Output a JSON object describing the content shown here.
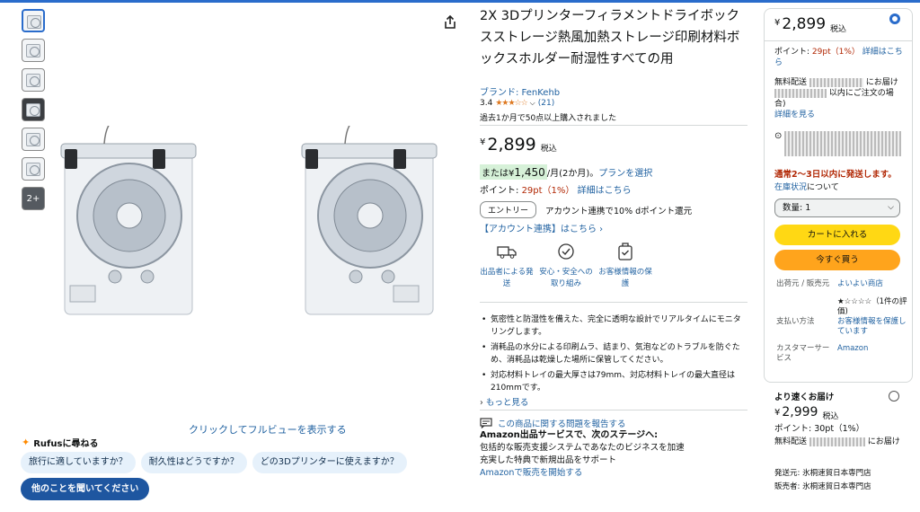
{
  "thumbnails": {
    "more_label": "2+"
  },
  "image": {
    "full_view_label": "クリックしてフルビューを表示する"
  },
  "rufus": {
    "title": "Rufusに尋ねる",
    "chips": [
      "旅行に適していますか？",
      "耐久性はどうですか？",
      "どの3Dプリンターに使えますか？"
    ],
    "ask_label": "他のことを聞いてください"
  },
  "product": {
    "title": "2X 3Dプリンターフィラメントドライボックスストレージ熱風加熱ストレージ印刷材料ボックスホルダー耐湿性すべての用",
    "brand": "ブランド: FenKehb",
    "rating": "3.4",
    "stars": "★★★☆☆",
    "rating_count": "(21)",
    "bought": "過去1か月で50点以上購入されました",
    "price_symbol": "¥",
    "price": "2,899",
    "tax_label": "税込",
    "installment_prefix": "または¥",
    "installment_amount": "1,450",
    "installment_suffix": " /月(2か月)。",
    "plan_link": "プランを選択",
    "points_label": "ポイント: ",
    "points_value": "29pt（1%）",
    "points_link": "詳細はこちら",
    "entry_label": "エントリー",
    "docomo_text": "アカウント連携で10% dポイント還元",
    "account_link": "【アカウント連携】はこちら ›",
    "features": [
      {
        "icon": "truck-icon",
        "label": "出品者による発送"
      },
      {
        "icon": "shield-icon",
        "label": "安心・安全への取り組み"
      },
      {
        "icon": "lock-icon",
        "label": "お客様情報の保護"
      }
    ],
    "bullets": [
      "気密性と防湿性を備えた、完全に透明な設計でリアルタイムにモニタリングします。",
      "消耗品の水分による印刷ムラ、詰まり、気泡などのトラブルを防ぐため、消耗品は乾燥した場所に保管してください。",
      "対応材料トレイの最大厚さは79mm、対応材料トレイの最大直径は210mmです。"
    ],
    "more_link": "もっと見る",
    "report_link": "この商品に関する問題を報告する",
    "amz_services_title": "Amazon出品サービスで、次のステージへ:",
    "amz_services_line1": "包括的な販売支援システムであなたのビジネスを加速",
    "amz_services_line2": "充実した特典で新規出品をサポート",
    "amz_services_link": "Amazonで販売を開始する"
  },
  "buybox": {
    "price_symbol": "¥",
    "price": "2,899",
    "tax_label": "税込",
    "points_label": "ポイント: ",
    "points_value": "29pt（1%）",
    "points_link": "詳細はこちら",
    "delivery_prefix": "無料配送",
    "delivery_suffix": "にお届け",
    "delivery_line2": "以内にご注文の場合)",
    "details_link": "詳細を見る",
    "ship_fast": "通常2～3日以内に発送します。",
    "stock_link": "在庫状況",
    "stock_suffix": "について",
    "qty_label": "数量: 1",
    "cart_label": "カートに入れる",
    "buy_label": "今すぐ買う",
    "info": [
      {
        "key": "出荷元 / 販売元",
        "value": "よいよい商店"
      },
      {
        "key": "支払い方法",
        "value": "お客様情報を保護しています"
      },
      {
        "key": "カスタマーサービス",
        "value": "Amazon"
      }
    ],
    "review_line": "★☆☆☆☆（1件の評価)",
    "second_offer": {
      "title": "より速くお届け",
      "price_symbol": "¥",
      "price": "2,999",
      "tax_label": "税込",
      "points": "ポイント: 30pt（1%）",
      "delivery_prefix": "無料配送",
      "delivery_suffix": "にお届け",
      "ship_from": "発送元: 氷桐速貿日本専門店",
      "seller": "販売者: 氷桐速貿日本専門店"
    }
  }
}
